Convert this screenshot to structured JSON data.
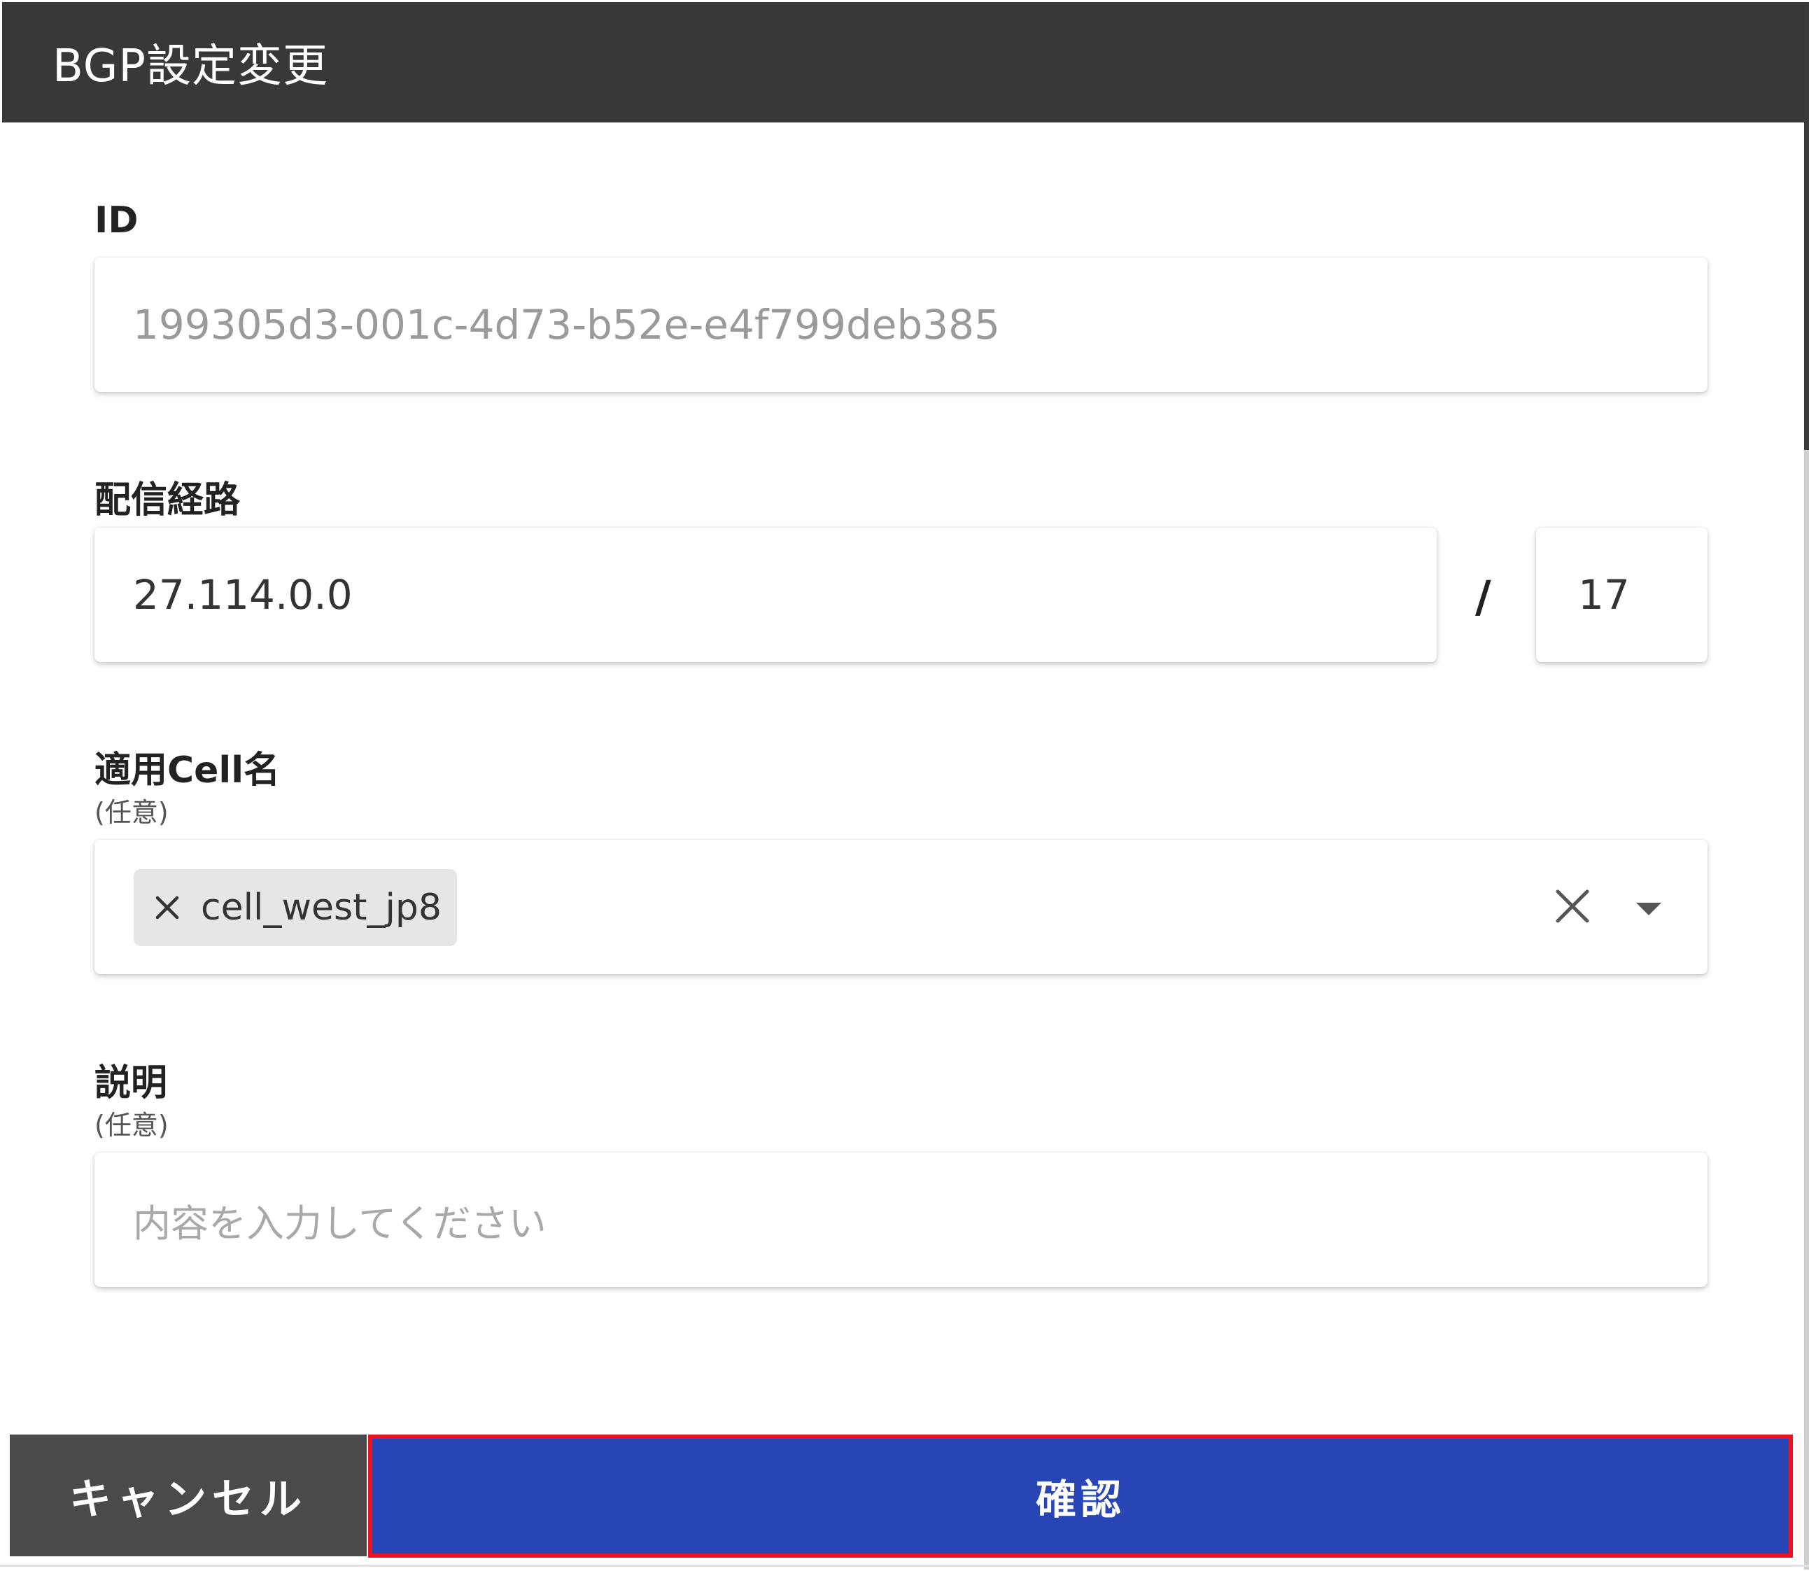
{
  "dialog": {
    "title": "BGP設定変更"
  },
  "form": {
    "id": {
      "label": "ID",
      "value": "199305d3-001c-4d73-b52e-e4f799deb385"
    },
    "route": {
      "label": "配信経路",
      "address": "27.114.0.0",
      "separator": "/",
      "prefix": "17"
    },
    "cell": {
      "label": "適用Cell名",
      "optional": "(任意)",
      "selected_chip": "cell_west_jp8"
    },
    "description": {
      "label": "説明",
      "optional": "(任意)",
      "placeholder": "内容を入力してください"
    }
  },
  "actions": {
    "cancel_label": "キャンセル",
    "confirm_label": "確認"
  },
  "colors": {
    "header_bg": "#383838",
    "confirm_bg": "#2845b5",
    "highlight_border": "#e8141e",
    "cancel_bg": "#4a4a4a"
  }
}
